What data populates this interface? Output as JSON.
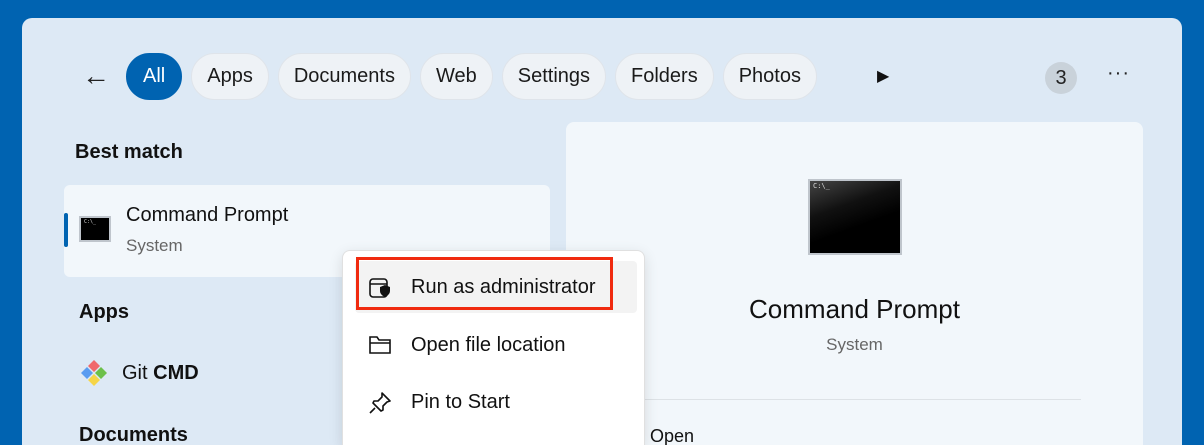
{
  "filters": {
    "back_label": "Back",
    "chips": [
      "All",
      "Apps",
      "Documents",
      "Web",
      "Settings",
      "Folders",
      "Photos"
    ],
    "active": "All",
    "result_count": "3"
  },
  "results": {
    "best_match_heading": "Best match",
    "best_match": {
      "title": "Command Prompt",
      "subtitle": "System"
    },
    "apps_heading": "Apps",
    "apps": [
      {
        "title_prefix": "Git ",
        "title_bold": "CMD"
      }
    ],
    "documents_heading": "Documents"
  },
  "context_menu": {
    "items": [
      "Run as administrator",
      "Open file location",
      "Pin to Start"
    ]
  },
  "detail": {
    "title": "Command Prompt",
    "subtitle": "System",
    "actions": [
      "Open"
    ]
  },
  "colors": {
    "accent": "#0063b1",
    "highlight": "#f02a0f"
  }
}
